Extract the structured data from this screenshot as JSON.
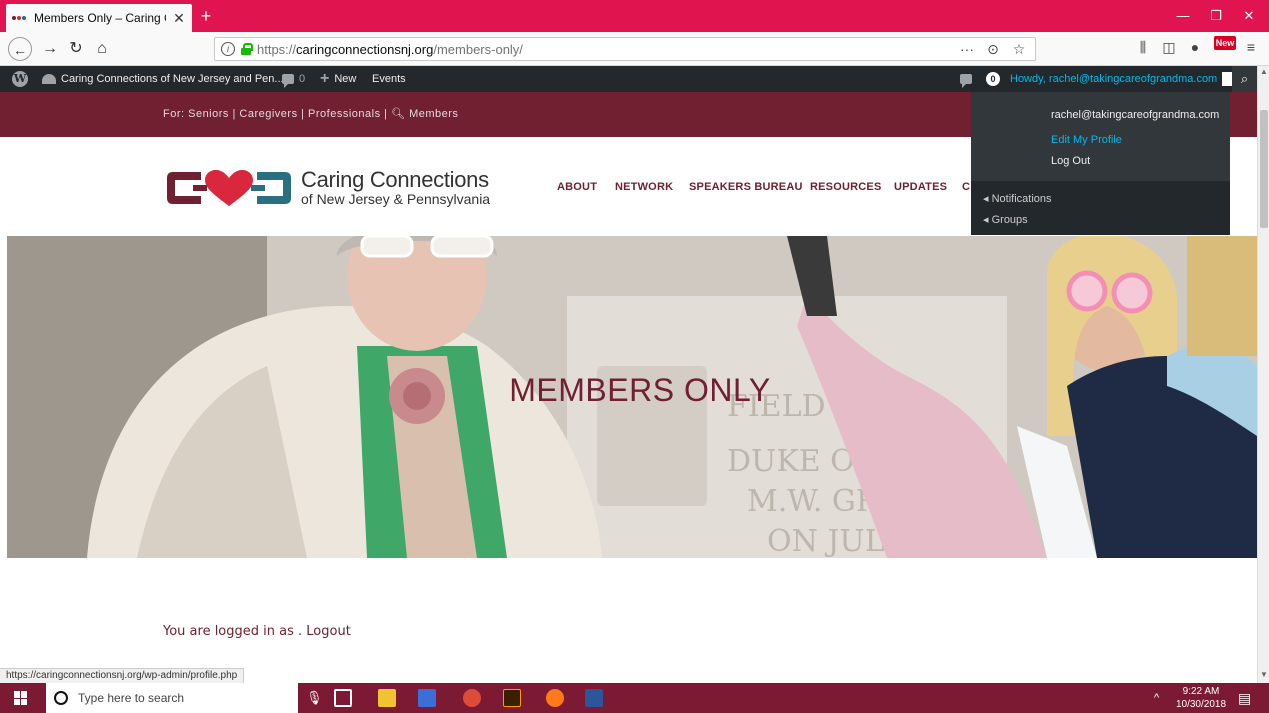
{
  "browser": {
    "tab_title": "Members Only – Caring Connec",
    "tab_close": "✕",
    "new_tab": "+",
    "win_minimize": "—",
    "win_restore": "❐",
    "win_close": "✕",
    "url_protocol": "https://",
    "url_host": "caringconnectionsnj.org",
    "url_path": "/members-only/",
    "url_more": "···",
    "new_badge": "New",
    "status_url": "https://caringconnectionsnj.org/wp-admin/profile.php"
  },
  "wp_admin_bar": {
    "site_name": "Caring Connections of New Jersey and Pen...",
    "comments_count": "0",
    "new_label": "New",
    "events_label": "Events",
    "notif_count": "0",
    "howdy": "Howdy, rachel@takingcareofgrandma.com",
    "dropdown": {
      "email": "rachel@takingcareofgrandma.com",
      "edit_profile": "Edit My Profile",
      "log_out": "Log Out",
      "notifications": "Notifications",
      "groups": "Groups"
    }
  },
  "site": {
    "top_strip": "For: Seniors | Caregivers | Professionals |",
    "top_strip_members": "Members",
    "logo_name": "Caring Connections",
    "logo_sub": "of New Jersey & Pennsylvania",
    "nav": [
      "ABOUT",
      "NETWORK",
      "SPEAKERS BUREAU",
      "RESOURCES",
      "UPDATES",
      "C"
    ],
    "hero_title": "MEMBERS ONLY",
    "logged_in_text": "You are logged in as . ",
    "logout_link": "Logout"
  },
  "taskbar": {
    "search_placeholder": "Type here to search",
    "time": "9:22 AM",
    "date": "10/30/2018"
  },
  "colors": {
    "browser_accent": "#e0144f",
    "brand_maroon": "#702030",
    "brand_teal": "#2a6f7f",
    "brand_heart": "#d9283d",
    "wp_bar": "#23282d",
    "wp_link": "#00b9eb"
  }
}
